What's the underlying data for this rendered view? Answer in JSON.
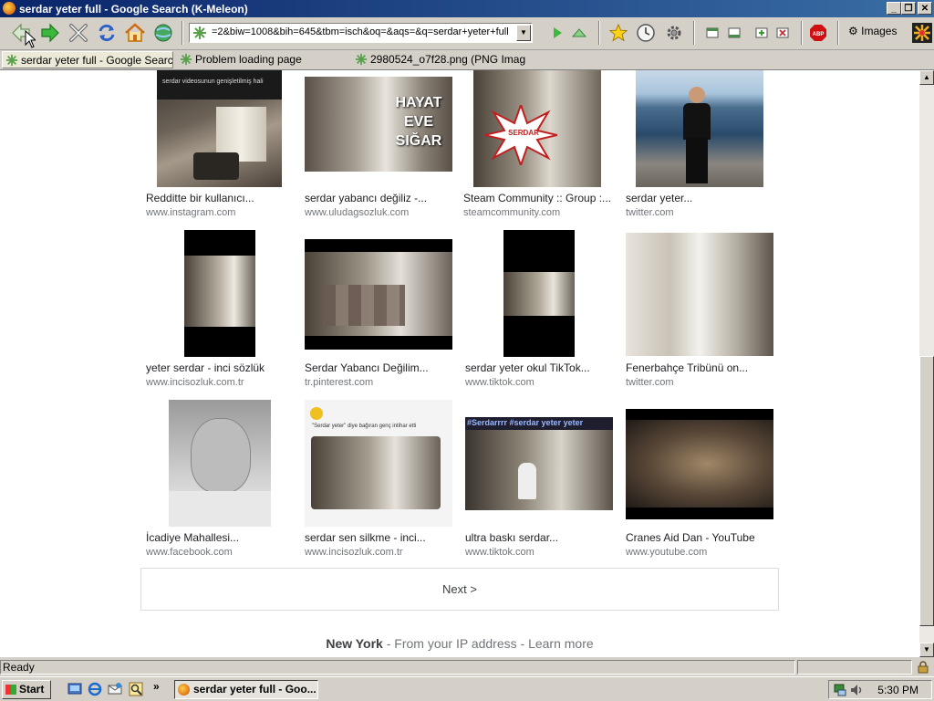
{
  "window": {
    "title": "serdar yeter full - Google Search (K-Meleon)"
  },
  "toolbar": {
    "url": "=2&biw=1008&bih=645&tbm=isch&oq=&aqs=&q=serdar+yeter+full",
    "images_label": "Images"
  },
  "tabs": [
    {
      "label": "serdar yeter full - Google Search"
    },
    {
      "label": "Problem loading page"
    },
    {
      "label": "2980524_o7f28.png (PNG Imag..."
    }
  ],
  "results": [
    {
      "caption": "Redditte bir kullanıcı...",
      "source": "www.instagram.com",
      "overlay": "serdar videosunun genişletilmiş hali"
    },
    {
      "caption": "serdar yabancı değiliz -...",
      "source": "www.uludagsozluk.com",
      "overlay": "HAYAT EVE SIĞAR"
    },
    {
      "caption": "Steam Community :: Group :...",
      "source": "steamcommunity.com",
      "overlay": "SERDAR"
    },
    {
      "caption": "serdar yeter...",
      "source": "twitter.com"
    },
    {
      "caption": "yeter serdar - inci sözlük",
      "source": "www.incisozluk.com.tr"
    },
    {
      "caption": "Serdar Yabancı Değilim...",
      "source": "tr.pinterest.com"
    },
    {
      "caption": "serdar yeter okul TikTok...",
      "source": "www.tiktok.com"
    },
    {
      "caption": "Fenerbahçe Tribünü on...",
      "source": "twitter.com"
    },
    {
      "caption": "İcadiye Mahallesi...",
      "source": "www.facebook.com"
    },
    {
      "caption": "serdar sen silkme - inci...",
      "source": "www.incisozluk.com.tr",
      "overlay": "\"Serdar yeter\" diye bağıran genç intihar etti"
    },
    {
      "caption": "ultra baskı serdar...",
      "source": "www.tiktok.com",
      "overlay": "#Serdarrrr #serdar yeter yeter"
    },
    {
      "caption": "Cranes Aid Dan - YouTube",
      "source": "www.youtube.com"
    }
  ],
  "next_label": "Next >",
  "location": {
    "city": "New York",
    "middle": " - From your IP address - ",
    "learn": "Learn more"
  },
  "status": {
    "text": "Ready"
  },
  "taskbar": {
    "start": "Start",
    "task": "serdar yeter full - Goo...",
    "clock": "5:30 PM"
  }
}
